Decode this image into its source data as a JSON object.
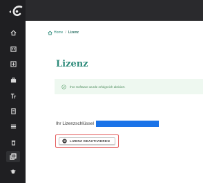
{
  "breadcrumb": {
    "home": "Home",
    "separator": "/",
    "current": "Lizenz"
  },
  "page": {
    "title": "Lizenz",
    "alert": "Ihre Software wurde erfolgreich aktiviert.",
    "license_label": "Ihr Lizenzschlüssel"
  },
  "actions": {
    "deactivate_label": "LIZENZ DEAKTIVIEREN"
  },
  "sidebar": {
    "items": [
      {
        "icon": "home-icon"
      },
      {
        "icon": "calendar-icon"
      },
      {
        "icon": "grid-icon"
      },
      {
        "icon": "briefcase-icon"
      },
      {
        "icon": "text-icon"
      },
      {
        "icon": "document-icon"
      },
      {
        "icon": "list-icon"
      },
      {
        "icon": "trash-icon"
      },
      {
        "icon": "license-icon",
        "active": true
      },
      {
        "icon": "graduation-icon"
      }
    ]
  },
  "colors": {
    "sidebar": "#1f1f22",
    "topbar": "#2a2a2d",
    "accent": "#2d8a7a",
    "alert_bg": "#eef8f0",
    "license_redaction": "#1a73e8",
    "highlight": "#e35a5a"
  }
}
